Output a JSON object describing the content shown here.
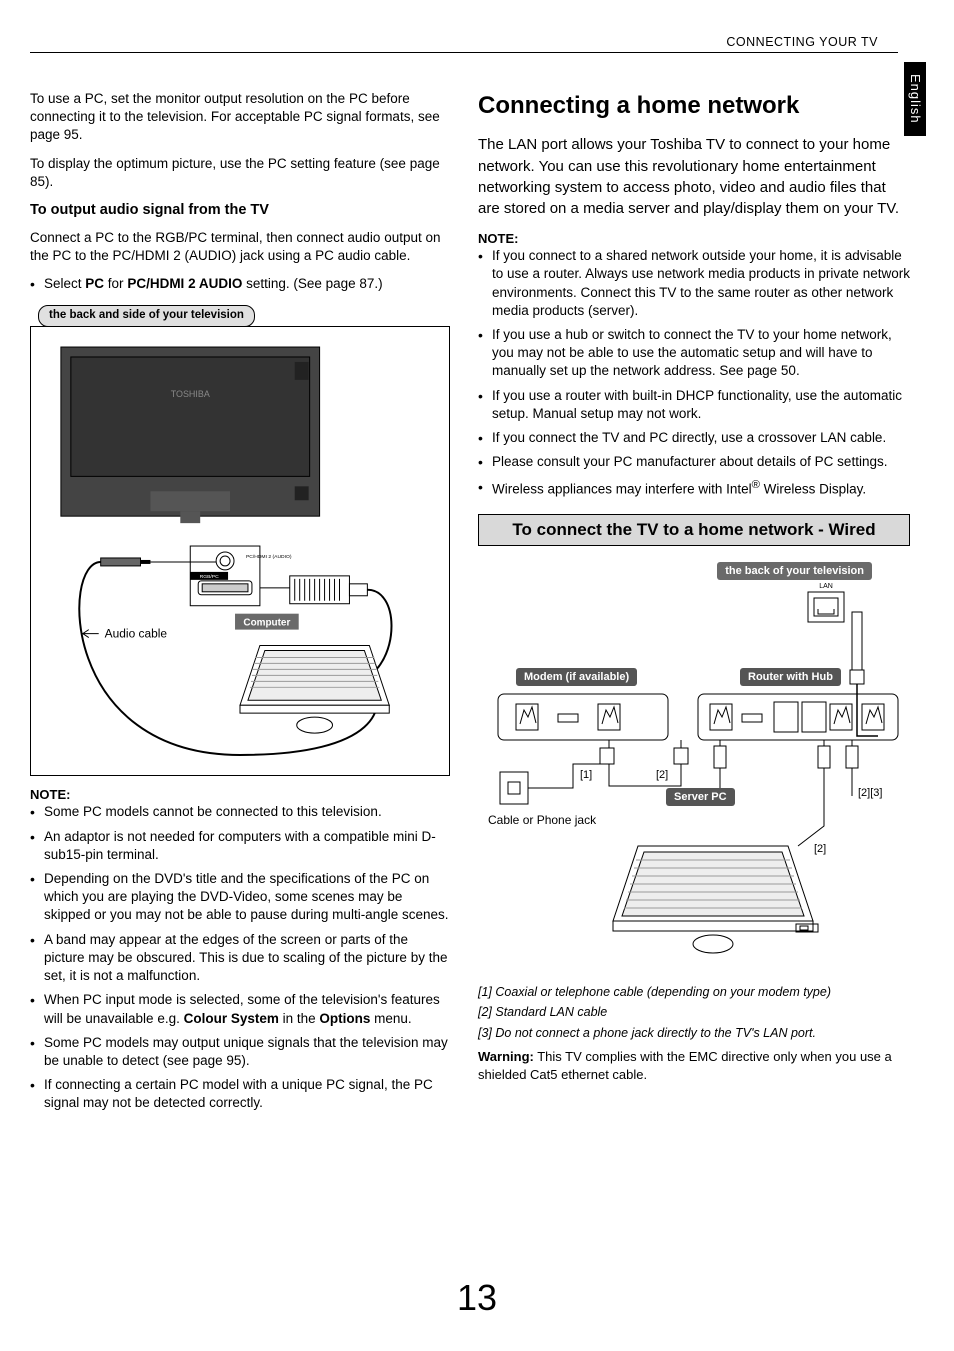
{
  "header": "CONNECTING YOUR TV",
  "sideTab": "English",
  "left": {
    "p1": "To use a PC, set the monitor output resolution on the PC before connecting it to the television. For acceptable PC signal formats, see page 95.",
    "p2": "To display the optimum picture, use the PC setting feature (see page 85).",
    "h_output": "To output audio signal from the TV",
    "p3": "Connect a PC to the RGB/PC terminal, then connect audio output on the PC to the PC/HDMI 2 (AUDIO) jack using a PC audio cable.",
    "bullet_select_pre": "Select ",
    "bullet_select_b1": "PC",
    "bullet_select_mid": " for ",
    "bullet_select_b2": "PC/HDMI 2 AUDIO",
    "bullet_select_post": " setting. (See page 87.)",
    "fig1_caption": "the back and side of your television",
    "fig1_computer": "Computer",
    "fig1_audio": "Audio cable",
    "fig1_port": "PC/HDMI 2 (AUDIO)",
    "fig1_rgb": "RGB/PC",
    "fig1_toshiba": "TOSHIBA",
    "note_label": "NOTE:",
    "notes": [
      "Some PC models cannot be connected to this television.",
      "An adaptor is not needed for computers with a compatible mini D-sub15-pin terminal.",
      "Depending on the DVD's title and the specifications of the PC on which you are playing the DVD-Video, some scenes may be skipped or you may not be able to pause during multi-angle scenes.",
      "A band may appear at the edges of the screen or parts of the picture may be obscured. This is due to scaling of the picture by the set, it is not a malfunction."
    ],
    "note5_pre": "When PC input mode is selected, some of the television's features will be unavailable e.g. ",
    "note5_b1": "Colour System",
    "note5_mid": " in the ",
    "note5_b2": "Options",
    "note5_post": " menu.",
    "note6": "Some PC models may output unique signals that the television may be unable to detect (see page 95).",
    "note7": "If connecting a certain PC model with a unique PC signal, the PC signal may not be detected correctly."
  },
  "right": {
    "title": "Connecting a home network",
    "intro": "The LAN port allows your Toshiba TV to connect to your home network. You can use this revolutionary home entertainment networking system to access photo, video and audio files that are stored on a media server and play/display them on your TV.",
    "note_label": "NOTE:",
    "notes": [
      "If you connect to a shared network outside your home, it is advisable to use a router. Always use network media products in private network environments. Connect this TV to the same router as other network media products (server).",
      "If you use a hub or switch to connect the TV to your home network, you may not be able to use the automatic setup and will have to manually set up the network address. See page 50.",
      "If you use a router with built-in DHCP functionality, use the automatic setup. Manual setup may not work.",
      "If you connect the TV and PC directly, use a crossover LAN cable.",
      "Please consult your PC manufacturer about details of PC settings."
    ],
    "note_wireless_pre": "Wireless appliances may interfere with Intel",
    "note_wireless_sup": "®",
    "note_wireless_post": " Wireless Display.",
    "section_title": "To connect the TV to a home network - Wired",
    "fig2_caption": "the back of your television",
    "fig2_lan": "LAN",
    "fig2_modem": "Modem (if available)",
    "fig2_router": "Router with Hub",
    "fig2_server": "Server PC",
    "fig2_jack": "Cable or Phone jack",
    "fig2_ref1": "[1]",
    "fig2_ref2a": "[2]",
    "fig2_ref2b": "[2]",
    "fig2_ref23": "[2][3]",
    "footnotes": [
      "[1] Coaxial or telephone cable (depending on your modem type)",
      "[2] Standard LAN cable",
      "[3] Do not connect a phone jack directly to the TV's LAN port."
    ],
    "warning_b": "Warning:",
    "warning_text": " This TV complies with the EMC directive only when you use a shielded Cat5 ethernet cable."
  },
  "pageNumber": "13"
}
